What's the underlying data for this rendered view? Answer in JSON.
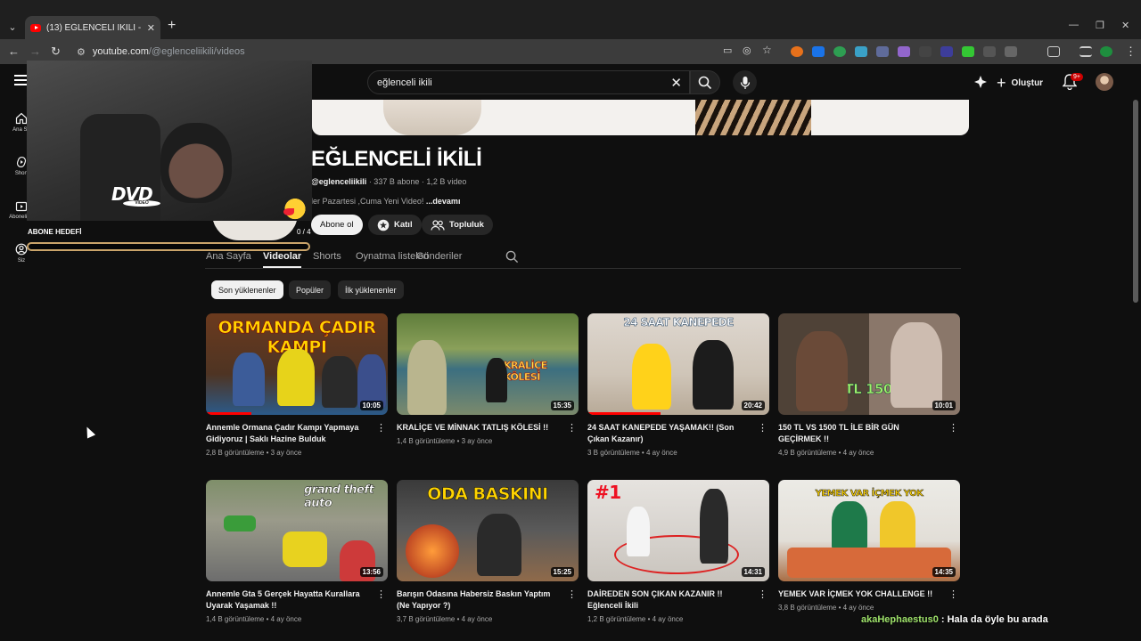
{
  "browser": {
    "tab_title": "(13) EĞLENCELİ İKİLİ - YouTube",
    "url_host": "youtube.com",
    "url_path": "/@eglenceliikili/videos"
  },
  "topbar": {
    "search_value": "eğlenceli ikili",
    "create_label": "Oluştur",
    "notification_count": "9+"
  },
  "sidebar": {
    "items": [
      {
        "label": "Ana Sa",
        "icon": "home-icon"
      },
      {
        "label": "Short",
        "icon": "shorts-icon"
      },
      {
        "label": "Abonelikle",
        "icon": "subscriptions-icon"
      },
      {
        "label": "Siz",
        "icon": "you-icon"
      }
    ]
  },
  "channel": {
    "name": "EĞLENCELİ İKİLİ",
    "handle": "@eglenceliikili",
    "stats": " · 337 B abone · 1,2 B video",
    "description": "ler Pazartesi ,Cuma Yeni Video! ",
    "more": "...devamı",
    "subscribe": "Abone ol",
    "join": "Katıl",
    "community": "Topluluk"
  },
  "tabs": [
    "Ana Sayfa",
    "Videolar",
    "Shorts",
    "Oynatma listeleri",
    "Gönderiler"
  ],
  "chips": [
    "Son yüklenenler",
    "Popüler",
    "İlk yüklenenler"
  ],
  "videos": [
    {
      "title": "Annemle Ormana Çadır Kampı Yapmaya Gidiyoruz | Saklı Hazine Bulduk",
      "views": "2,8 B görüntüleme",
      "age": "3 ay önce",
      "duration": "10:05",
      "caption": "ORMANDA ÇADIR KAMPI",
      "progress": 0.25
    },
    {
      "title": "KRALİÇE VE MİNNAK TATLIŞ KÖLESİ !!",
      "views": "1,4 B görüntüleme",
      "age": "3 ay önce",
      "duration": "15:35",
      "caption": "KRALİÇE KÖLESİ",
      "progress": 0
    },
    {
      "title": "24 SAAT KANEPEDE YAŞAMAK!! (Son Çıkan Kazanır)",
      "views": "3 B görüntüleme",
      "age": "4 ay önce",
      "duration": "20:42",
      "caption": "24 SAAT KANEPEDE",
      "progress": 0.4
    },
    {
      "title": "150 TL VS 1500 TL İLE BİR GÜN GEÇİRMEK !!",
      "views": "4,9 B görüntüleme",
      "age": "4 ay önce",
      "duration": "10:01",
      "caption": "150 TL   1500 TL",
      "progress": 0
    },
    {
      "title": "Annemle Gta 5 Gerçek Hayatta Kurallara Uyarak Yaşamak !!",
      "views": "1,4 B görüntüleme",
      "age": "4 ay önce",
      "duration": "13:56",
      "caption": "grand theft auto",
      "progress": 0
    },
    {
      "title": "Barışın Odasına Habersiz Baskın Yaptım (Ne Yapıyor ?)",
      "views": "3,7 B görüntüleme",
      "age": "4 ay önce",
      "duration": "15:25",
      "caption": "ODA BASKINI",
      "progress": 0
    },
    {
      "title": "DAİREDEN SON ÇIKAN KAZANIR !! Eğlenceli İkili",
      "views": "1,2 B görüntüleme",
      "age": "4 ay önce",
      "duration": "14:31",
      "caption": "#1",
      "progress": 0
    },
    {
      "title": "YEMEK VAR İÇMEK YOK CHALLENGE !!",
      "views": "3,8 B görüntüleme",
      "age": "4 ay önce",
      "duration": "14:35",
      "caption": "YEMEK VAR   İÇMEK YOK",
      "progress": 0
    }
  ],
  "overlay": {
    "goal_label": "ABONE HEDEFİ",
    "goal_count": "0 / 4",
    "dvd_text": "DVD",
    "dvd_sub": "VIDEO",
    "chat_user": "akaHephaestus0",
    "chat_text": " : Hala da öyle bu arada"
  },
  "colors": {
    "accent": "#ff0000",
    "background": "#0f0f0f",
    "chip_bg": "#272727"
  }
}
